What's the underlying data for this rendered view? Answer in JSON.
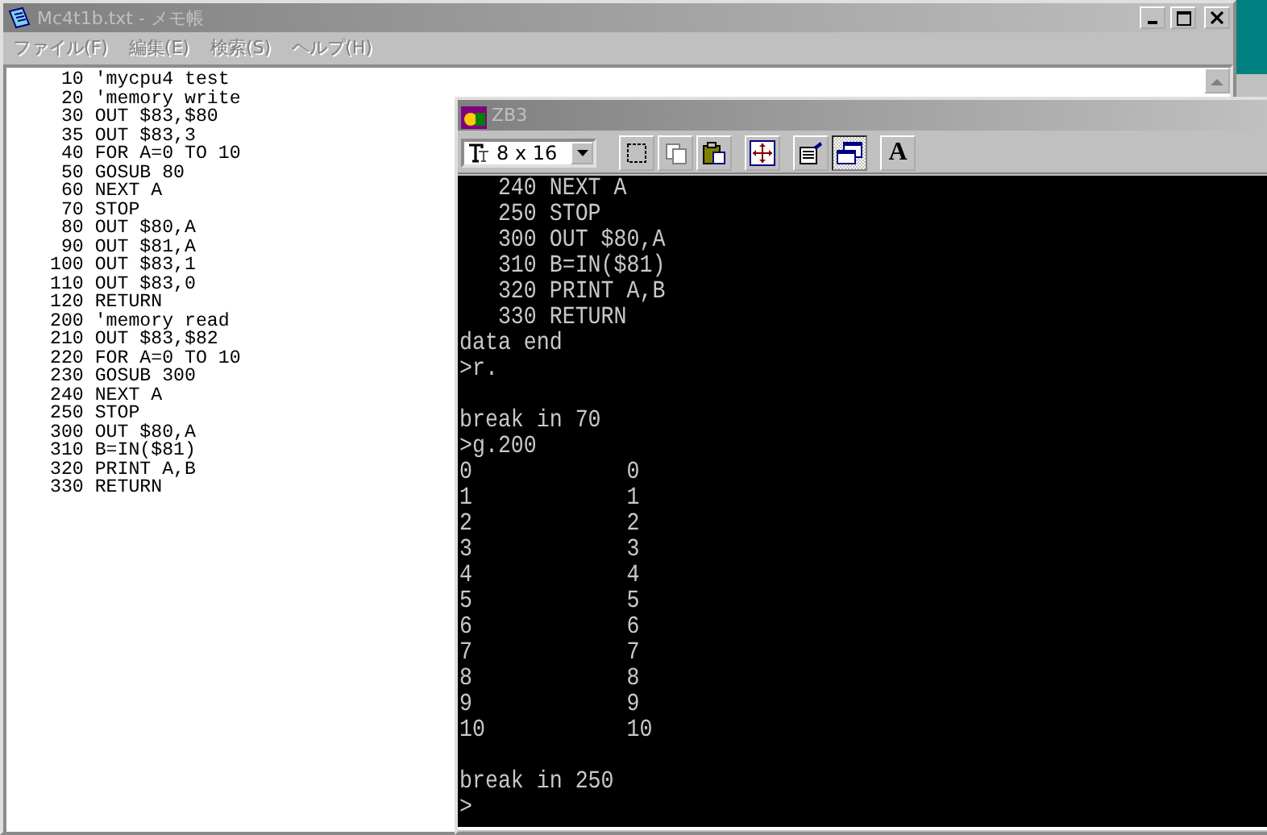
{
  "notepad": {
    "title": "Mc4t1b.txt - メモ帳",
    "active": false,
    "menu": [
      {
        "label": "ファイル(F)",
        "disabled": true
      },
      {
        "label": "編集(E)",
        "disabled": true
      },
      {
        "label": "検索(S)",
        "disabled": true
      },
      {
        "label": "ヘルプ(H)",
        "disabled": true
      }
    ],
    "lines": [
      " 10 'mycpu4 test",
      " 20 'memory write",
      " 30 OUT $83,$80",
      " 35 OUT $83,3",
      " 40 FOR A=0 TO 10",
      " 50 GOSUB 80",
      " 60 NEXT A",
      " 70 STOP",
      " 80 OUT $80,A",
      " 90 OUT $81,A",
      "100 OUT $83,1",
      "110 OUT $83,0",
      "120 RETURN",
      "200 'memory read",
      "210 OUT $83,$82",
      "220 FOR A=0 TO 10",
      "230 GOSUB 300",
      "240 NEXT A",
      "250 STOP",
      "300 OUT $80,A",
      "310 B=IN($81)",
      "320 PRINT A,B",
      "330 RETURN"
    ]
  },
  "console": {
    "title": "ZB3",
    "active": false,
    "font_size": "8 x 16",
    "toolbar": [
      {
        "kind": "select",
        "pressed": false
      },
      {
        "kind": "copy",
        "pressed": false
      },
      {
        "kind": "paste",
        "pressed": false
      },
      {
        "kind": "move",
        "pressed": false
      },
      {
        "kind": "properties",
        "pressed": false
      },
      {
        "kind": "window",
        "pressed": true
      },
      {
        "kind": "font",
        "label": "A",
        "pressed": false
      }
    ],
    "blocks": [
      [
        "   240 NEXT A",
        "   250 STOP",
        "   300 OUT $80,A",
        "   310 B=IN($81)",
        "   320 PRINT A,B",
        "   330 RETURN",
        "data end",
        ">r."
      ],
      [
        "break in 70",
        ">g.200",
        "0            0",
        "1            1",
        "2            2",
        "3            3",
        "4            4",
        "5            5",
        "6            6",
        "7            7",
        "8            8",
        "9            9",
        "10           10"
      ],
      [
        "break in 250",
        ">"
      ]
    ]
  }
}
